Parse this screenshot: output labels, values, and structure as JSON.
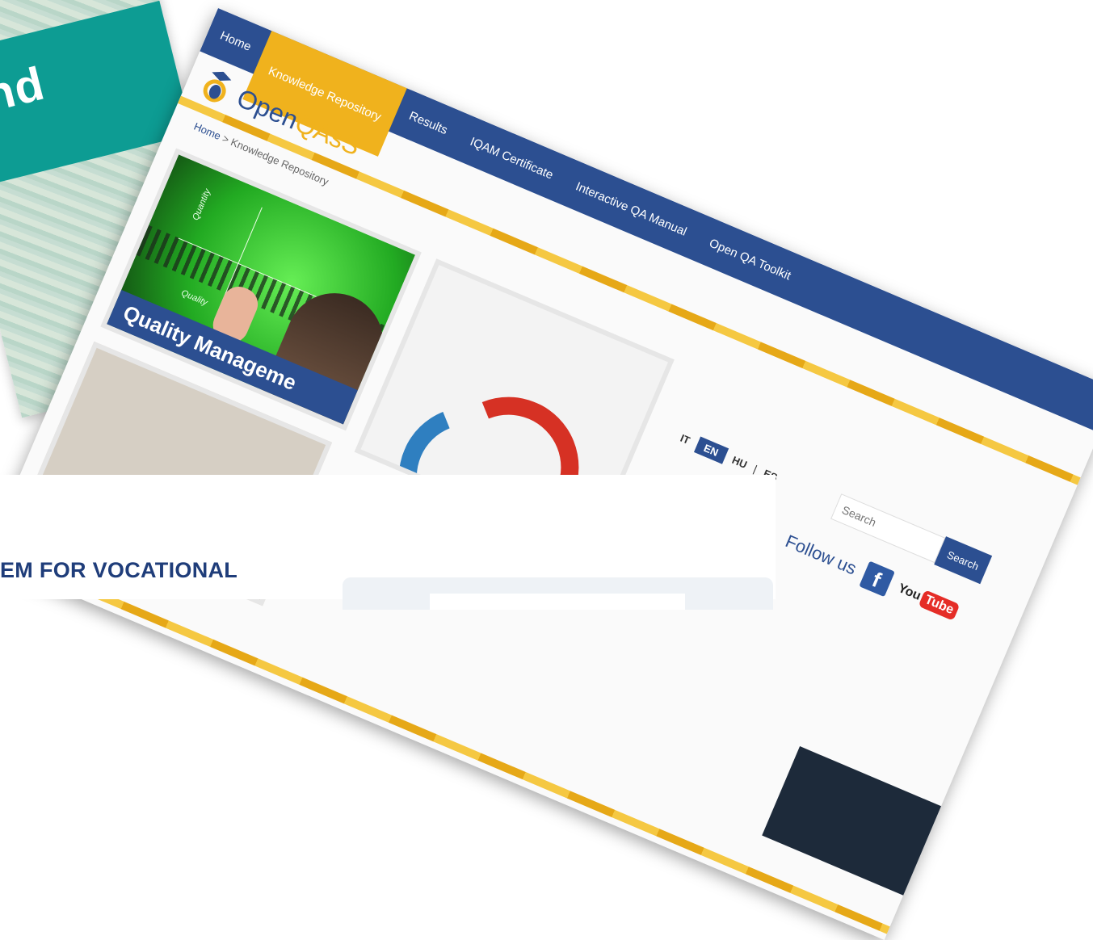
{
  "background_card": {
    "text": "and",
    "accent": "#0d9c93"
  },
  "site": {
    "colors": {
      "brand": "#2c4f91",
      "accent": "#f0b21d"
    },
    "nav": [
      {
        "label": "Home"
      },
      {
        "label": "Knowledge Repository",
        "active": true
      },
      {
        "label": "Results"
      },
      {
        "label": "IQAM Certificate"
      },
      {
        "label": "Interactive QA Manual"
      },
      {
        "label": "Open QA Toolkit"
      }
    ],
    "logo": {
      "text_primary": "Open",
      "text_accent": "QAsS"
    },
    "breadcrumb": {
      "home": "Home",
      "separator": " > ",
      "current": "Knowledge Repository"
    },
    "tile1": {
      "axis_y_label": "Quantity",
      "axis_x_label": "Quality",
      "caption": "Quality Manageme"
    },
    "languages": [
      {
        "code": "IT"
      },
      {
        "code": "EN",
        "selected": true
      },
      {
        "code": "HU"
      },
      {
        "code": "|"
      },
      {
        "code": "ES"
      }
    ],
    "search": {
      "placeholder": "Search",
      "button_label": "Search"
    },
    "follow": {
      "label": "Follow us",
      "facebook_glyph": "f",
      "youtube_you": "You",
      "youtube_tube": "Tube"
    }
  },
  "panel": {
    "heading": "EM FOR VOCATIONAL"
  }
}
